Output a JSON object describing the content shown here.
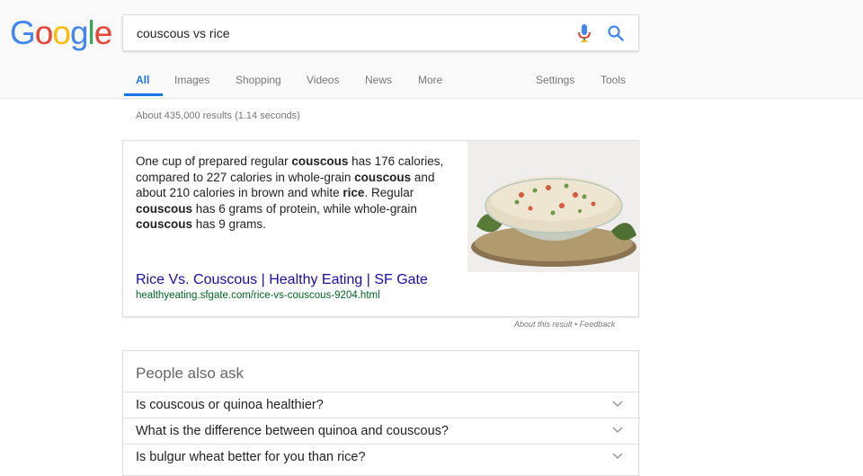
{
  "logo": {
    "letters": [
      "G",
      "o",
      "o",
      "g",
      "l",
      "e"
    ],
    "colors": [
      "#4285f4",
      "#ea4335",
      "#fbbc05",
      "#4285f4",
      "#34a853",
      "#ea4335"
    ]
  },
  "search": {
    "query": "couscous vs rice"
  },
  "tabs": [
    {
      "label": "All"
    },
    {
      "label": "Images"
    },
    {
      "label": "Shopping"
    },
    {
      "label": "Videos"
    },
    {
      "label": "News"
    },
    {
      "label": "More"
    }
  ],
  "tools": {
    "settings": "Settings",
    "tools": "Tools"
  },
  "stats": "About 435,000 results (1.14 seconds)",
  "snippet": {
    "parts": [
      {
        "t": "One cup of prepared regular ",
        "b": false
      },
      {
        "t": "couscous",
        "b": true
      },
      {
        "t": " has 176 calories, compared to 227 calories in whole-grain ",
        "b": false
      },
      {
        "t": "couscous",
        "b": true
      },
      {
        "t": " and about 210 calories in brown and white ",
        "b": false
      },
      {
        "t": "rice",
        "b": true
      },
      {
        "t": ". Regular ",
        "b": false
      },
      {
        "t": "couscous",
        "b": true
      },
      {
        "t": " has 6 grams of protein, while whole-grain ",
        "b": false
      },
      {
        "t": "couscous",
        "b": true
      },
      {
        "t": " has 9 grams.",
        "b": false
      }
    ],
    "link": "Rice Vs. Couscous | Healthy Eating | SF Gate",
    "url": "healthyeating.sfgate.com/rice-vs-couscous-9204.html"
  },
  "about": "About this result • Feedback",
  "paa": {
    "title": "People also ask",
    "questions": [
      "Is couscous or quinoa healthier?",
      "What is the difference between quinoa and couscous?",
      "Is bulgur wheat better for you than rice?"
    ]
  },
  "colors": {
    "accent": "#1a73e8",
    "link": "#1a0dab",
    "url": "#006621"
  }
}
